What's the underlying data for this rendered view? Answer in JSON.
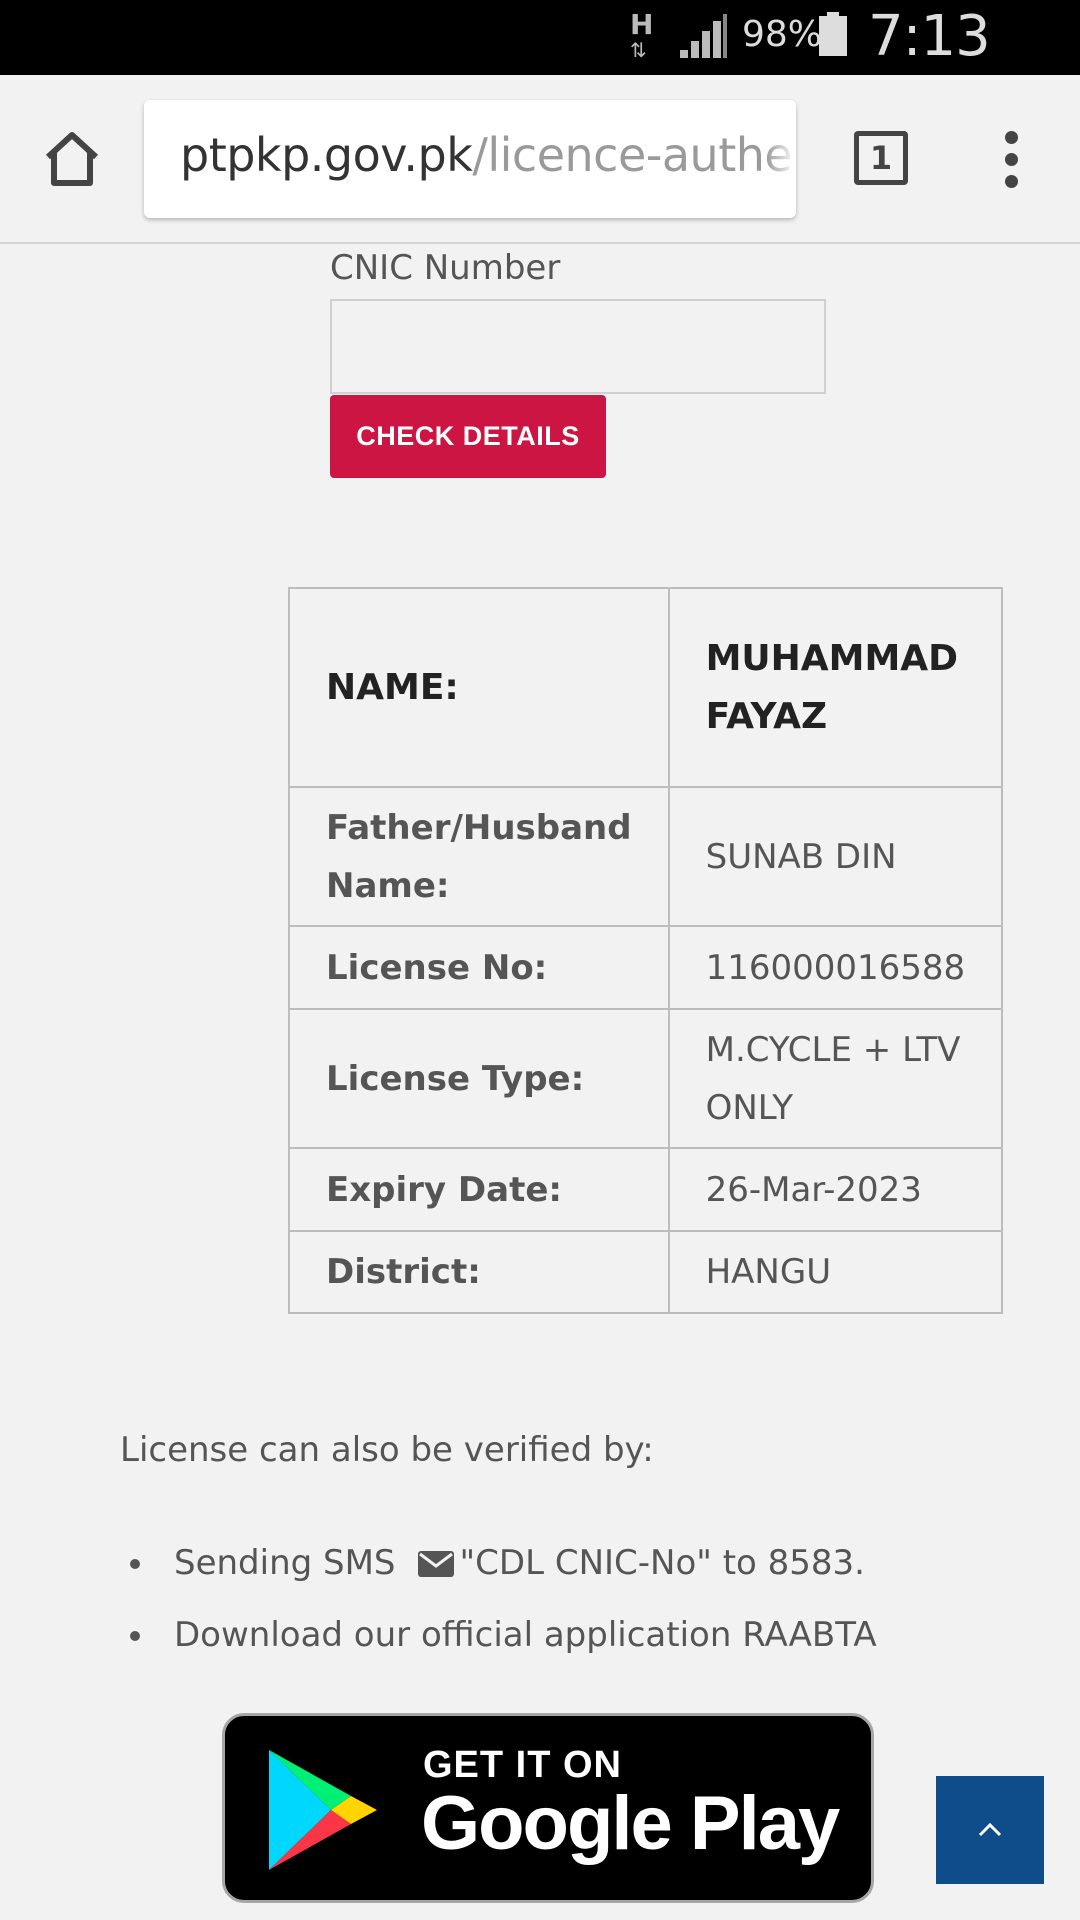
{
  "status_bar": {
    "network_type": "H",
    "battery_percent": "98%",
    "time": "7:13 PM"
  },
  "browser": {
    "url_host": "ptpkp.gov.pk",
    "url_path": "/licence-authen",
    "tab_count": "1"
  },
  "form": {
    "cnic_label": "CNIC Number",
    "cnic_value": "",
    "check_button": "CHECK DETAILS"
  },
  "details": [
    {
      "label": "NAME:",
      "value": "MUHAMMAD FAYAZ"
    },
    {
      "label": "Father/Husband Name:",
      "value": "SUNAB DIN"
    },
    {
      "label": "License No:",
      "value": "116000016588"
    },
    {
      "label": "License Type:",
      "value": "M.CYCLE + LTV ONLY"
    },
    {
      "label": "Expiry Date:",
      "value": "26-Mar-2023"
    },
    {
      "label": "District:",
      "value": "HANGU"
    }
  ],
  "verify": {
    "intro": "License can also be verified by:",
    "sms_prefix": "Sending SMS",
    "sms_text": "\"CDL CNIC-No\" to 8583.",
    "app_text": "Download our official application RAABTA"
  },
  "google_play": {
    "line1": "GET IT ON",
    "line2": "Google Play"
  },
  "icons": {
    "home": "home-icon",
    "tabs": "tabs-icon",
    "menu": "more-vert-icon",
    "mail": "envelope-icon",
    "scroll_top": "chevron-up-icon"
  },
  "colors": {
    "check_button": "#cc1543",
    "scroll_top": "#0f4c8a",
    "background": "#f2f2f2"
  }
}
